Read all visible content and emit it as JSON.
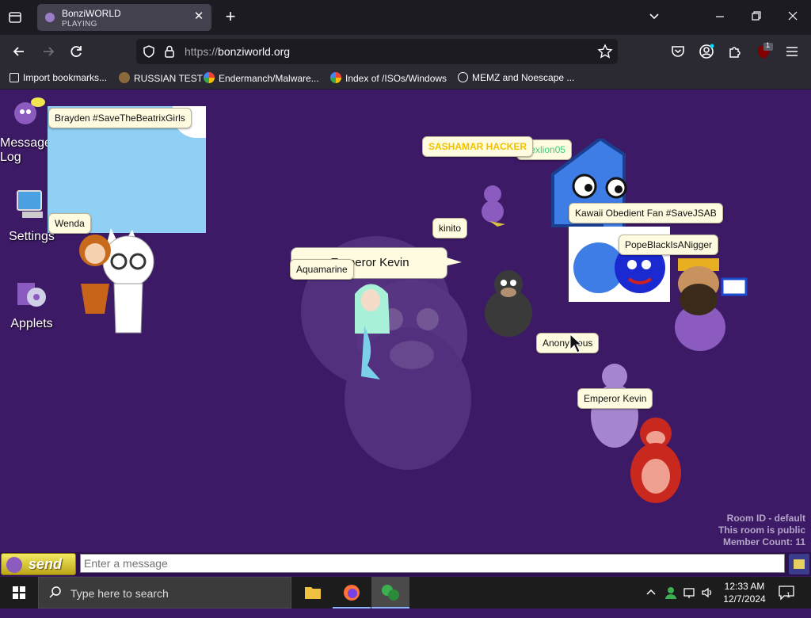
{
  "browser": {
    "tab": {
      "title": "BonziWORLD",
      "subtitle": "PLAYING"
    },
    "url": {
      "protocol": "https://",
      "host": "bonziworld.org"
    },
    "bookmarks": [
      {
        "label": "Import bookmarks..."
      },
      {
        "label": "RUSSIAN TEST"
      },
      {
        "label": "Endermanch/Malware..."
      },
      {
        "label": "Index of /ISOs/Windows"
      },
      {
        "label": "MEMZ and Noescape ..."
      }
    ],
    "extension_badge": "1"
  },
  "desktop_icons": [
    {
      "label": "Message Log",
      "icon": "purple-gorilla-chat-icon"
    },
    {
      "label": "Settings",
      "icon": "computer-settings-icon"
    },
    {
      "label": "Applets",
      "icon": "applets-box-icon"
    }
  ],
  "users": [
    {
      "name": "Brayden #SaveTheBeatrixGirls"
    },
    {
      "name": "Wenda"
    },
    {
      "name": "SASHAMAR HACKER"
    },
    {
      "name": "alexlion05"
    },
    {
      "name": "kinito"
    },
    {
      "name": "Kawaii Obedient Fan #SaveJSAB"
    },
    {
      "name": "PopeBlackIsANigger"
    },
    {
      "name": "Aquamarine"
    },
    {
      "name": "Anonymous"
    },
    {
      "name": "Emperor Kevin"
    }
  ],
  "speech": {
    "text": "Emperor Kevin"
  },
  "room": {
    "id_label": "Room ID - default",
    "public_label": "This room is public",
    "member_label": "Member Count: 11"
  },
  "chat": {
    "send_label": "send",
    "placeholder": "Enter a message"
  },
  "taskbar": {
    "search_placeholder": "Type here to search",
    "time": "12:33 AM",
    "date": "12/7/2024",
    "notification_count": "1"
  },
  "colors": {
    "page_bg": "#3d1a66",
    "bubble_bg": "#fffbe0",
    "send_yellow": "#e6d93a",
    "sasha_text": "#f2c200",
    "alex_text": "#3ad07a"
  }
}
